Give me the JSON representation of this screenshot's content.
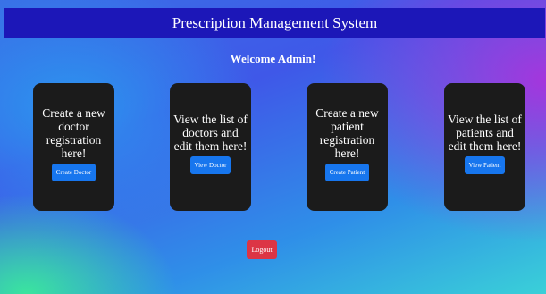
{
  "header": {
    "title": "Prescription Management System"
  },
  "welcome": "Welcome Admin!",
  "cards": [
    {
      "text": "Create a new doctor registration here!",
      "button": "Create Doctor"
    },
    {
      "text": "View the list of doctors and edit them here!",
      "button": "View Doctor"
    },
    {
      "text": "Create a new patient registration here!",
      "button": "Create Patient"
    },
    {
      "text": "View the list of patients and edit them here!",
      "button": "View Patient"
    }
  ],
  "logout": "Logout",
  "colors": {
    "header_bg": "#1c17b8",
    "card_bg": "#1b1b1b",
    "primary_button": "#1776ee",
    "logout_button": "#dc3545"
  }
}
